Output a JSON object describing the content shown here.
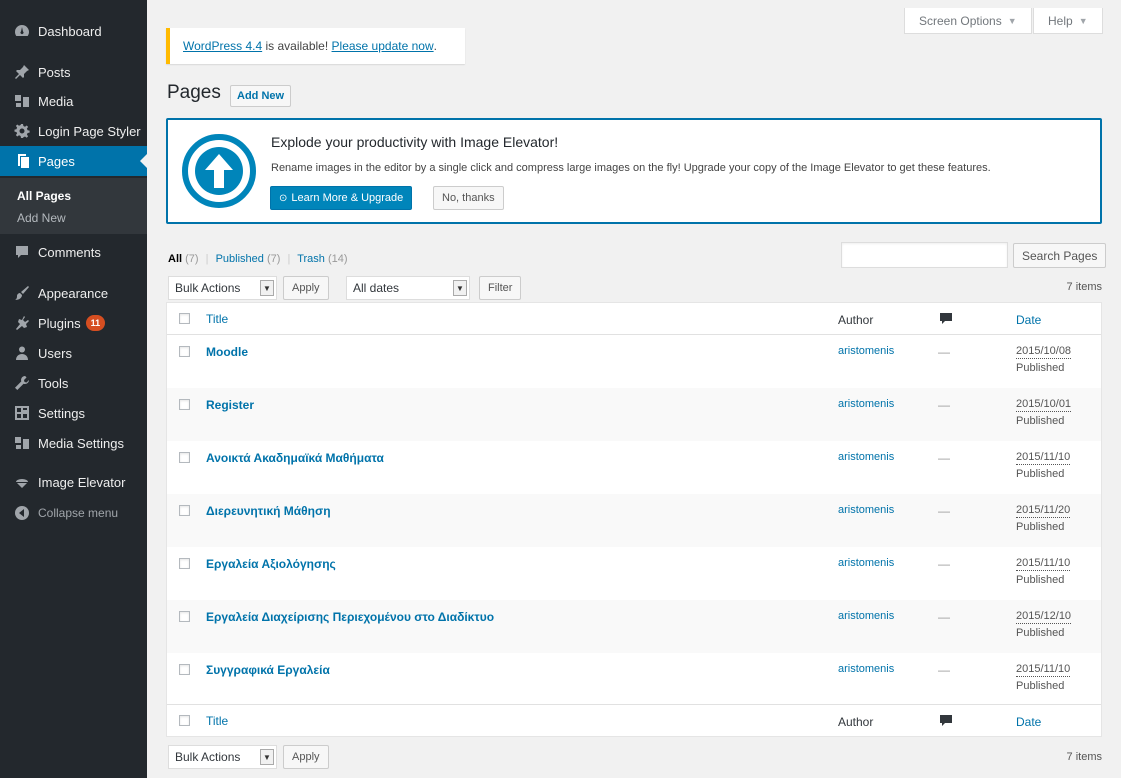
{
  "sidebar": {
    "items": [
      {
        "label": "Dashboard",
        "icon": "dashboard-icon"
      },
      {
        "label": "Posts",
        "icon": "pin-icon"
      },
      {
        "label": "Media",
        "icon": "media-icon"
      },
      {
        "label": "Login Page Styler",
        "icon": "gear-icon"
      },
      {
        "label": "Pages",
        "icon": "pages-icon"
      },
      {
        "label": "Comments",
        "icon": "comments-icon"
      },
      {
        "label": "Appearance",
        "icon": "brush-icon"
      },
      {
        "label": "Plugins",
        "icon": "plugin-icon",
        "badge": "11"
      },
      {
        "label": "Users",
        "icon": "users-icon"
      },
      {
        "label": "Tools",
        "icon": "wrench-icon"
      },
      {
        "label": "Settings",
        "icon": "settings-icon"
      },
      {
        "label": "Media Settings",
        "icon": "media-icon"
      },
      {
        "label": "Image Elevator",
        "icon": "elevator-icon"
      },
      {
        "label": "Collapse menu",
        "icon": "collapse-icon"
      }
    ],
    "submenu": [
      "All Pages",
      "Add New"
    ]
  },
  "screen_meta": {
    "screen_options": "Screen Options",
    "help": "Help"
  },
  "notice": {
    "link1": "WordPress 4.4",
    "text": " is available! ",
    "link2": "Please update now",
    "end": "."
  },
  "header": {
    "title": "Pages",
    "add_new": "Add New"
  },
  "promo": {
    "title": "Explode your productivity with Image Elevator!",
    "text": "Rename images in the editor by a single click and compress large images on the fly! Upgrade your copy of the Image Elevator to get these features.",
    "primary": "Learn More & Upgrade",
    "secondary": "No, thanks"
  },
  "views": {
    "all": "All",
    "all_count": "(7)",
    "published": "Published",
    "published_count": "(7)",
    "trash": "Trash",
    "trash_count": "(14)",
    "sep": "|"
  },
  "search": {
    "button": "Search Pages"
  },
  "tablenav": {
    "bulk_actions": "Bulk Actions",
    "apply": "Apply",
    "dates": "All dates",
    "filter": "Filter",
    "items": "7 items"
  },
  "columns": {
    "title": "Title",
    "author": "Author",
    "date": "Date",
    "comments_icon": "comment-bubble-icon"
  },
  "rows": [
    {
      "title": "Moodle",
      "author": "aristomenis",
      "comments": "—",
      "date": "2015/10/08",
      "status": "Published"
    },
    {
      "title": "Register",
      "author": "aristomenis",
      "comments": "—",
      "date": "2015/10/01",
      "status": "Published"
    },
    {
      "title": "Ανοικτά Ακαδημαϊκά Μαθήματα",
      "author": "aristomenis",
      "comments": "—",
      "date": "2015/11/10",
      "status": "Published"
    },
    {
      "title": "Διερευνητική Μάθηση",
      "author": "aristomenis",
      "comments": "—",
      "date": "2015/11/20",
      "status": "Published"
    },
    {
      "title": "Εργαλεία Αξιολόγησης",
      "author": "aristomenis",
      "comments": "—",
      "date": "2015/11/10",
      "status": "Published"
    },
    {
      "title": "Εργαλεία Διαχείρισης Περιεχομένου στο Διαδίκτυο",
      "author": "aristomenis",
      "comments": "—",
      "date": "2015/12/10",
      "status": "Published"
    },
    {
      "title": "Συγγραφικά Εργαλεία",
      "author": "aristomenis",
      "comments": "—",
      "date": "2015/11/10",
      "status": "Published"
    }
  ],
  "colors": {
    "sidebar_bg": "#23282d",
    "accent": "#0073aa",
    "badge": "#d54e21",
    "notice_border": "#ffba00"
  }
}
